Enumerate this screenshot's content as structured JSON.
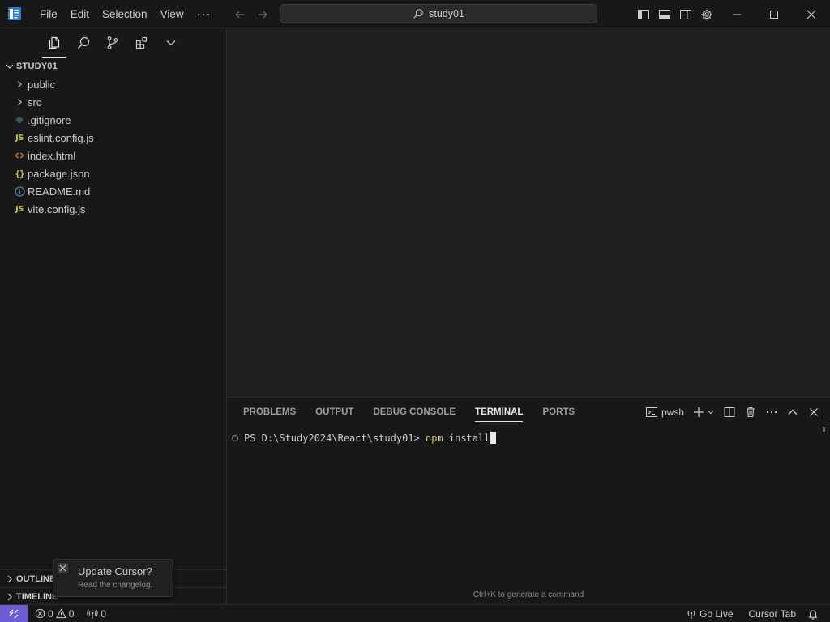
{
  "titlebar": {
    "menus": [
      "File",
      "Edit",
      "Selection",
      "View"
    ],
    "more": "···",
    "search_text": "study01"
  },
  "sidebar": {
    "section_title": "STUDY01",
    "items": [
      {
        "type": "folder",
        "name": "public",
        "icon": "chevron-right-icon"
      },
      {
        "type": "folder",
        "name": "src",
        "icon": "chevron-right-icon"
      },
      {
        "type": "file",
        "name": ".gitignore",
        "icon": "git-icon"
      },
      {
        "type": "file",
        "name": "eslint.config.js",
        "icon": "js-icon",
        "badge": "JS"
      },
      {
        "type": "file",
        "name": "index.html",
        "icon": "html-icon",
        "badge": "<>"
      },
      {
        "type": "file",
        "name": "package.json",
        "icon": "json-icon",
        "badge": "{}"
      },
      {
        "type": "file",
        "name": "README.md",
        "icon": "info-icon"
      },
      {
        "type": "file",
        "name": "vite.config.js",
        "icon": "js-icon",
        "badge": "JS"
      }
    ],
    "outline_label": "OUTLINE",
    "timeline_label": "TIMELINE"
  },
  "notification": {
    "title": "Update Cursor?",
    "subtitle": "Read the changelog."
  },
  "panel": {
    "tabs": [
      "PROBLEMS",
      "OUTPUT",
      "DEBUG CONSOLE",
      "TERMINAL",
      "PORTS"
    ],
    "active_tab": "TERMINAL",
    "shell_name": "pwsh",
    "prompt": "PS D:\\Study2024\\React\\study01> ",
    "command_name": "npm",
    "command_args": " install",
    "hint": "Ctrl+K to generate a command"
  },
  "statusbar": {
    "errors": "0",
    "warnings": "0",
    "ports": "0",
    "go_live": "Go Live",
    "cursor_tab": "Cursor Tab",
    "accent": "#6b5cd6"
  }
}
